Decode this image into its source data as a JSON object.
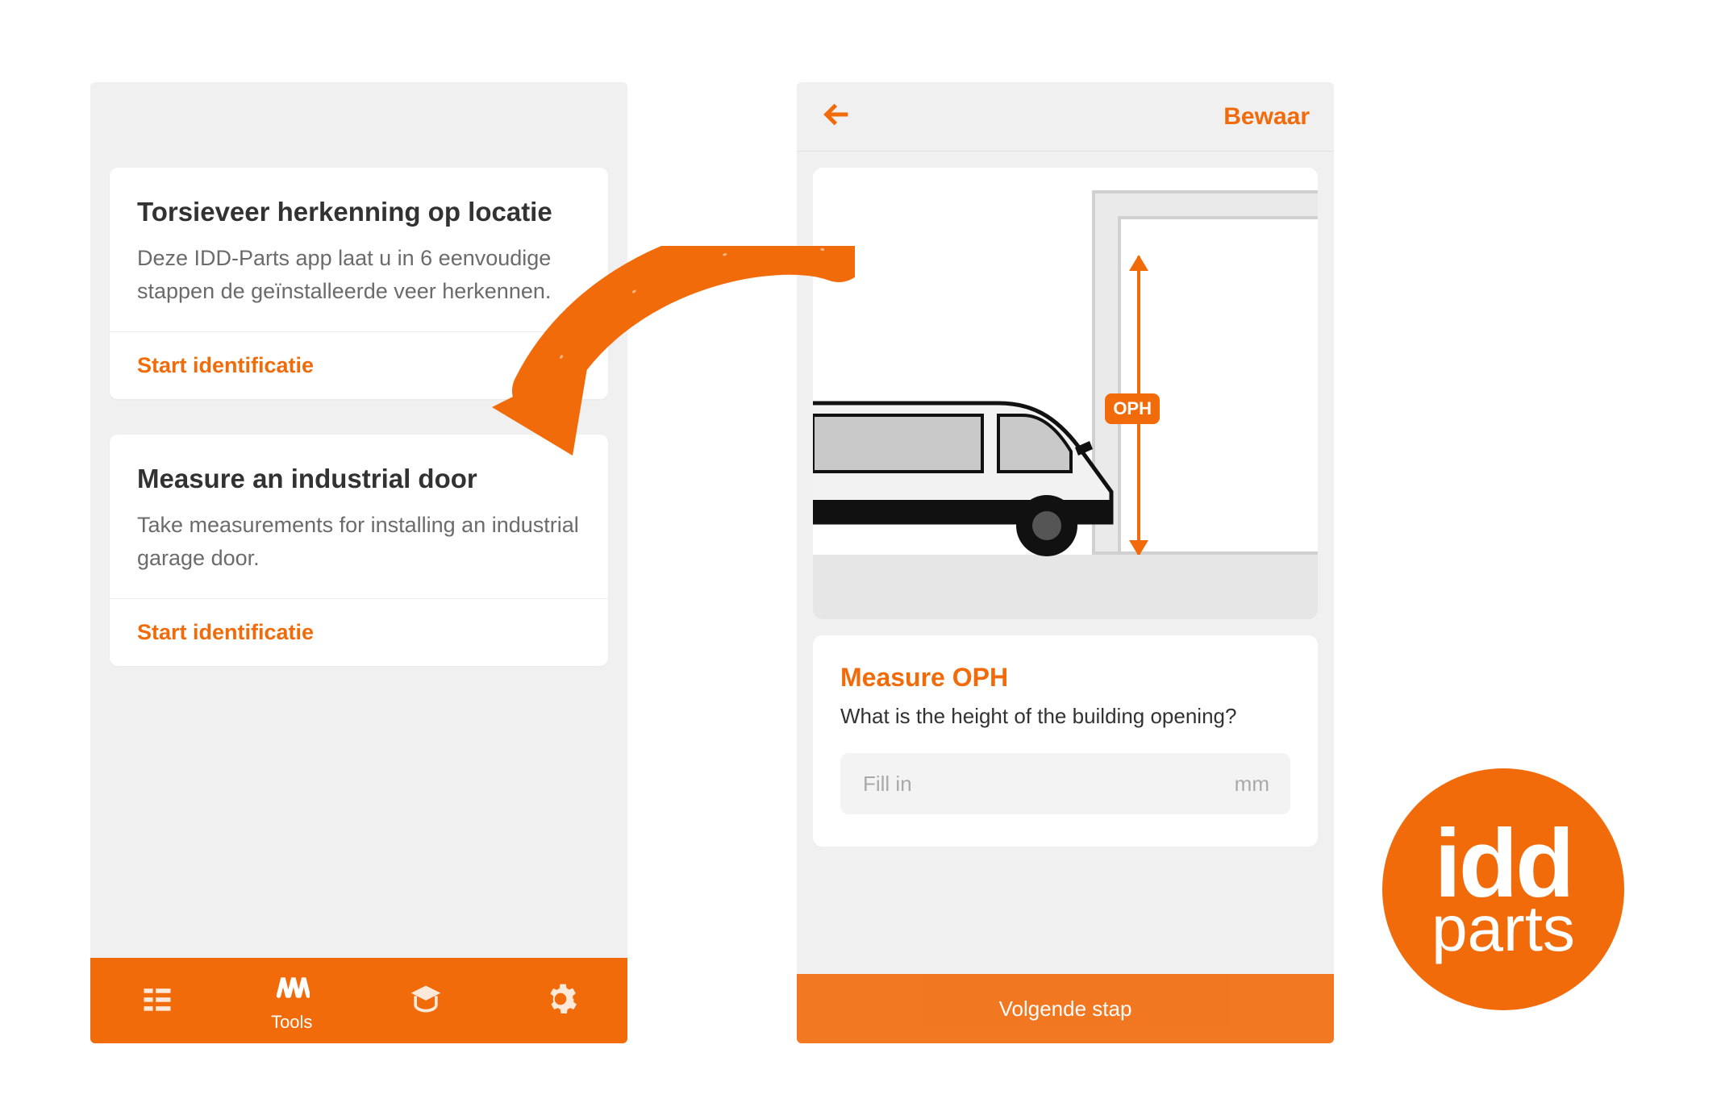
{
  "brand_badge": "IDD",
  "cards": [
    {
      "title": "Torsieveer herkenning op locatie",
      "desc": "Deze IDD-Parts app laat u in 6 eenvoudige stappen de geïnstalleerde veer herkennen.",
      "action": "Start identificatie"
    },
    {
      "title": "Measure an industrial door",
      "desc": "Take measurements for installing an industrial garage door.",
      "action": "Start identificatie"
    }
  ],
  "bottom_nav": {
    "items": [
      {
        "label": ""
      },
      {
        "label": "Tools"
      },
      {
        "label": ""
      },
      {
        "label": ""
      }
    ]
  },
  "screen2": {
    "save": "Bewaar",
    "oph_badge": "OPH",
    "measure_title": "Measure OPH",
    "measure_question": "What is the height of the building opening?",
    "placeholder": "Fill in",
    "unit": "mm",
    "next": "Volgende stap"
  },
  "logo": {
    "line1": "idd",
    "line2": "parts"
  }
}
